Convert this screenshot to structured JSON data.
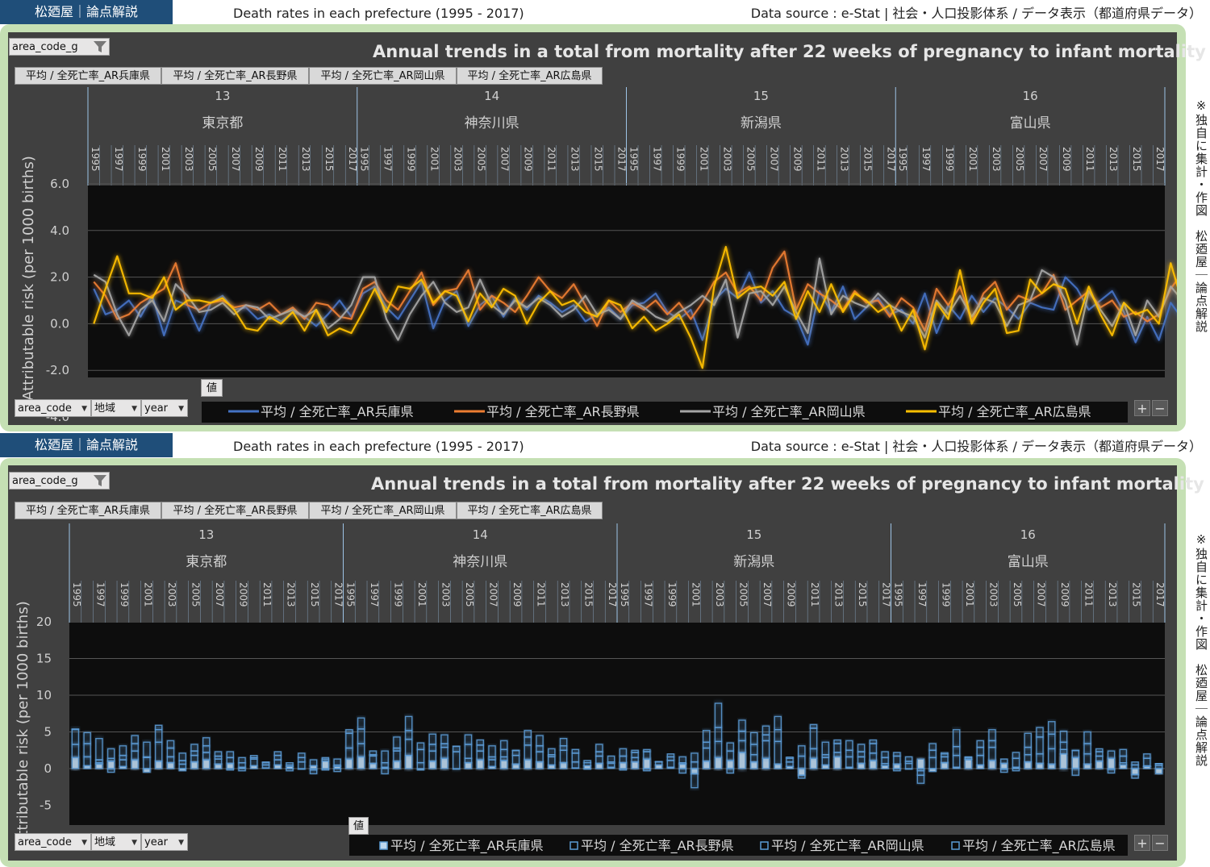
{
  "header": {
    "brand": "松廼屋｜論点解説",
    "title": "Death rates in each prefecture (1995 - 2017)",
    "source": "Data source : e-Stat | 社会・人口投影体系 / データ表示（都道府県データ）"
  },
  "side_note": "※独自に集計・作図　松廼屋｜論点解説",
  "controls": {
    "filter_area_code_g": "area_code_g",
    "row_fields": [
      "area_code",
      "地域",
      "year"
    ],
    "values_button": "値",
    "zoom_plus": "+",
    "zoom_minus": "−",
    "series_tags": [
      "平均 / 全死亡率_AR兵庫県",
      "平均 / 全死亡率_AR長野県",
      "平均 / 全死亡率_AR岡山県",
      "平均 / 全死亡率_AR広島県"
    ]
  },
  "icons": {
    "filter": "funnel-icon",
    "dropdown": "chevron-down-icon"
  },
  "colors": {
    "background": "#404040",
    "plot": "#0d0d0d",
    "hyogo": "#4472c4",
    "nagano": "#ed7d31",
    "okayama": "#a5a5a5",
    "hiroshima": "#ffc000",
    "bar_blue": "#5b9bd5"
  },
  "chart_data": [
    {
      "type": "line",
      "title": "Annual trends in a total from mortality after 22 weeks of pregnancy to infant mortality",
      "ylabel": "Attributable risk (per 1000 births)",
      "ylim": [
        -4,
        6
      ],
      "yticks": [
        "6.0",
        "4.0",
        "2.0",
        "0.0",
        "-2.0",
        "-4.0"
      ],
      "grid": true,
      "legend": "bottom",
      "groups": [
        {
          "code": "13",
          "name": "東京都",
          "years": [
            "1995",
            "1996",
            "1997",
            "1998",
            "1999",
            "2000",
            "2001",
            "2002",
            "2003",
            "2004",
            "2005",
            "2006",
            "2007",
            "2008",
            "2009",
            "2010",
            "2011",
            "2012",
            "2013",
            "2014",
            "2015",
            "2016",
            "2017"
          ]
        },
        {
          "code": "14",
          "name": "神奈川県",
          "years": [
            "1995",
            "1996",
            "1997",
            "1998",
            "1999",
            "2000",
            "2001",
            "2002",
            "2003",
            "2004",
            "2005",
            "2006",
            "2007",
            "2008",
            "2009",
            "2010",
            "2011",
            "2012",
            "2013",
            "2014",
            "2015",
            "2016",
            "2017"
          ]
        },
        {
          "code": "15",
          "name": "新潟県",
          "years": [
            "1995",
            "1996",
            "1997",
            "1998",
            "1999",
            "2000",
            "2001",
            "2002",
            "2003",
            "2004",
            "2005",
            "2006",
            "2007",
            "2008",
            "2009",
            "2010",
            "2011",
            "2012",
            "2013",
            "2014",
            "2015",
            "2016",
            "2017"
          ]
        },
        {
          "code": "16",
          "name": "富山県",
          "years": [
            "1995",
            "1996",
            "1997",
            "1998",
            "1999",
            "2000",
            "2001",
            "2002",
            "2003",
            "2004",
            "2005",
            "2006",
            "2007",
            "2008",
            "2009",
            "2010",
            "2011",
            "2012",
            "2013",
            "2014",
            "2015",
            "2016",
            "2017"
          ]
        }
      ],
      "series": [
        {
          "name": "平均 / 全死亡率_AR兵庫県",
          "values": [
            1.5,
            0.4,
            0.6,
            1.0,
            0.3,
            1.2,
            -0.5,
            1.0,
            0.8,
            -0.3,
            0.9,
            1.2,
            0.6,
            0.7,
            0.2,
            0.4,
            0.1,
            0.5,
            0.3,
            -0.1,
            0.4,
            1.0,
            0.3,
            1.3,
            1.6,
            0.7,
            0.2,
            1.0,
            1.8,
            -0.2,
            1.0,
            1.4,
            -0.1,
            0.8,
            1.2,
            0.3,
            1.1,
            0.6,
            1.2,
            0.9,
            0.5,
            0.8,
            0.1,
            0.4,
            0.7,
            0.2,
            0.8,
            0.9,
            1.3,
            0.5,
            0.2,
            0.6,
            -0.7,
            1.0,
            1.5,
            1.1,
            2.2,
            0.9,
            1.4,
            0.6,
            0.3,
            -0.9,
            1.4,
            0.5,
            1.6,
            0.2,
            0.7,
            1.1,
            0.4,
            0.6,
            0.0,
            1.3,
            -0.4,
            0.8,
            0.2,
            1.2,
            0.5,
            1.1,
            0.7,
            0.2,
            0.9,
            0.7,
            0.6,
            2.0,
            1.5,
            0.6,
            1.0,
            1.4,
            0.5,
            -0.8,
            0.3,
            -0.7,
            0.9,
            0.2,
            2.2,
            0.8,
            1.4,
            0.5,
            0.9,
            1.3,
            1.0,
            1.7,
            2.4,
            1.5,
            0.3
          ]
        },
        {
          "name": "平均 / 全死亡率_AR長野県",
          "values": [
            1.8,
            1.2,
            0.2,
            0.4,
            0.9,
            1.2,
            1.5,
            2.6,
            0.8,
            0.6,
            0.9,
            1.0,
            0.7,
            0.8,
            0.6,
            0.9,
            0.4,
            0.7,
            0.2,
            0.9,
            0.8,
            0.3,
            0.2,
            1.5,
            1.8,
            1.0,
            0.6,
            1.4,
            2.2,
            0.8,
            1.4,
            1.5,
            2.3,
            0.6,
            1.2,
            0.9,
            0.5,
            1.2,
            2.0,
            1.4,
            1.1,
            1.7,
            0.8,
            -0.1,
            1.0,
            0.5,
            0.9,
            0.6,
            1.0,
            0.4,
            0.9,
            0.2,
            0.9,
            1.8,
            2.2,
            1.3,
            1.6,
            1.0,
            2.4,
            3.1,
            0.6,
            1.7,
            1.3,
            1.0,
            0.6,
            1.4,
            0.9,
            1.0,
            0.3,
            1.1,
            0.7,
            -0.3,
            1.5,
            0.8,
            1.6,
            0.1,
            1.3,
            1.8,
            0.6,
            1.2,
            1.0,
            1.3,
            2.1,
            0.6,
            1.0,
            1.4,
            0.7,
            1.0,
            0.3,
            0.5,
            0.1,
            0.4,
            1.5,
            2.2,
            1.2,
            1.8,
            1.0,
            1.6,
            2.1,
            1.2,
            1.6,
            1.9,
            1.0,
            -0.1
          ]
        },
        {
          "name": "平均 / 全死亡率_AR岡山県",
          "values": [
            2.1,
            1.8,
            0.4,
            -0.5,
            0.6,
            1.0,
            0.1,
            1.7,
            1.2,
            0.5,
            0.6,
            0.9,
            0.4,
            0.8,
            0.7,
            0.2,
            0.4,
            0.6,
            0.3,
            0.6,
            -0.2,
            0.2,
            0.8,
            2.0,
            2.0,
            0.2,
            -0.7,
            0.4,
            1.2,
            1.8,
            0.9,
            0.5,
            0.7,
            1.9,
            0.8,
            0.4,
            1.0,
            0.7,
            1.1,
            0.8,
            0.3,
            0.6,
            1.2,
            0.4,
            0.6,
            0.2,
            1.0,
            0.7,
            0.3,
            0.1,
            0.5,
            0.8,
            1.2,
            0.8,
            1.9,
            -0.6,
            1.3,
            1.4,
            0.8,
            1.6,
            0.5,
            -0.4,
            2.8,
            0.4,
            1.2,
            0.9,
            0.7,
            1.3,
            0.8,
            0.5,
            0.3,
            -0.6,
            1.0,
            0.4,
            1.2,
            0.3,
            1.1,
            0.9,
            -0.1,
            0.8,
            1.0,
            2.3,
            2.0,
            1.0,
            -0.9,
            1.4,
            0.6,
            -0.1,
            0.9,
            -0.5,
            1.0,
            0.3,
            1.6,
            1.0,
            2.2,
            0.7,
            1.4,
            1.1,
            1.6,
            1.3,
            2.0,
            2.6,
            1.8,
            0.2
          ]
        },
        {
          "name": "平均 / 全死亡率_AR広島県",
          "values": [
            0.0,
            1.5,
            2.9,
            1.3,
            1.3,
            1.1,
            2.0,
            0.6,
            1.0,
            1.0,
            0.9,
            1.1,
            0.6,
            -0.2,
            -0.3,
            0.3,
            0.0,
            0.5,
            -0.3,
            0.6,
            -0.5,
            -0.2,
            -0.4,
            0.5,
            1.5,
            0.5,
            1.6,
            1.5,
            1.9,
            0.9,
            1.4,
            1.2,
            0.1,
            1.3,
            0.7,
            1.5,
            1.2,
            0.0,
            0.9,
            1.4,
            0.8,
            1.0,
            0.5,
            0.3,
            1.0,
            0.8,
            -0.2,
            0.3,
            -0.3,
            0.0,
            0.4,
            -0.6,
            -1.9,
            1.6,
            3.3,
            1.1,
            1.5,
            1.6,
            1.2,
            1.8,
            0.2,
            1.4,
            0.5,
            1.7,
            0.5,
            1.3,
            1.0,
            0.5,
            0.8,
            -0.3,
            0.6,
            -1.1,
            0.9,
            0.2,
            2.3,
            0.0,
            0.9,
            1.5,
            -0.4,
            -0.3,
            1.9,
            1.3,
            1.7,
            1.5,
            0.0,
            1.6,
            0.4,
            -0.5,
            0.9,
            0.4,
            0.6,
            0.0,
            2.6,
            0.9,
            2.4,
            0.0,
            0.5,
            0.8,
            1.1,
            1.6,
            2.5,
            2.3,
            -0.2,
            -0.9
          ]
        }
      ]
    },
    {
      "type": "bar",
      "title": "Annual trends in a total from mortality after 22 weeks of pregnancy to infant mortality",
      "ylabel": "Attributable risk (per 1000 births)",
      "ylim": [
        -5,
        20
      ],
      "yticks": [
        "20",
        "15",
        "10",
        "5",
        "0",
        "-5"
      ],
      "stacked": true,
      "grid": true,
      "legend": "bottom",
      "groups_same_as_chart_1": true
    }
  ]
}
